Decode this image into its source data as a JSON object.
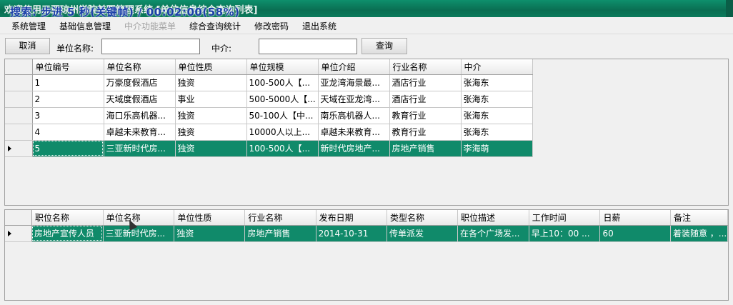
{
  "window": {
    "title": "欢迎使用三亚琼州学院兼职管理系统 [单位信息综合查询列表]",
    "overlay": "搜索: 步进 5 秒(关键帧) / 00:02:00(58%)"
  },
  "menu": [
    "系统管理",
    "基础信息管理",
    "中介功能菜单",
    "综合查询统计",
    "修改密码",
    "退出系统"
  ],
  "toolbar": {
    "cancel_label": "取消",
    "unit_name_label": "单位名称:",
    "unit_name_value": "",
    "agent_label": "中介:",
    "agent_value": "",
    "query_label": "查询"
  },
  "units_grid": {
    "columns": [
      "单位编号",
      "单位名称",
      "单位性质",
      "单位规模",
      "单位介绍",
      "行业名称",
      "中介"
    ],
    "rows": [
      [
        "1",
        "万豪度假酒店",
        "独资",
        "100-500人【...",
        "亚龙湾海景最...",
        "酒店行业",
        "张海东"
      ],
      [
        "2",
        "天域度假酒店",
        "事业",
        "500-5000人【...",
        "天域在亚龙湾...",
        "酒店行业",
        "张海东"
      ],
      [
        "3",
        "海口乐高机器...",
        "独资",
        "50-100人【中...",
        "南乐高机器人...",
        "教育行业",
        "张海东"
      ],
      [
        "4",
        "卓越未来教育...",
        "独资",
        "10000人以上...",
        "卓越未来教育...",
        "教育行业",
        "张海东"
      ],
      [
        "5",
        "三亚新时代房...",
        "独资",
        "100-500人【...",
        "新时代房地产...",
        "房地产销售",
        "李海萌"
      ]
    ],
    "selected_row": 4
  },
  "jobs_grid": {
    "columns": [
      "职位名称",
      "单位名称",
      "单位性质",
      "行业名称",
      "发布日期",
      "类型名称",
      "职位描述",
      "工作时间",
      "日薪",
      "备注"
    ],
    "rows": [
      [
        "房地产宣传人员",
        "三亚新时代房...",
        "独资",
        "房地产销售",
        "2014-10-31",
        "传单派发",
        "在各个广场发...",
        "早上10：00 ...",
        "60",
        "着装随意 ，..."
      ]
    ],
    "selected_row": 0
  }
}
